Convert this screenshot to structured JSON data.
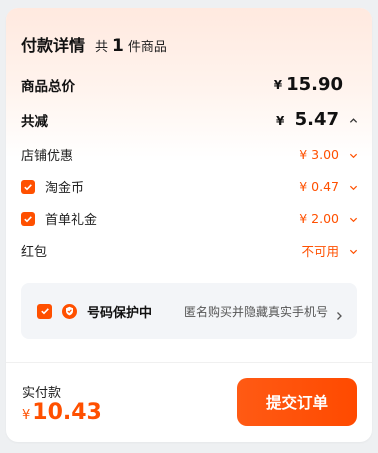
{
  "header": {
    "title": "付款详情",
    "count_prefix": "共",
    "count_num": "1",
    "count_suffix": "件商品"
  },
  "rows": {
    "total": {
      "label": "商品总价",
      "currency": "¥",
      "value": "15.90"
    },
    "reduce": {
      "label": "共减",
      "currency": "¥",
      "value": "5.47"
    },
    "store": {
      "label": "店铺优惠",
      "currency": "¥",
      "value": "3.00"
    },
    "coin": {
      "label": "淘金币",
      "currency": "¥",
      "value": "0.47",
      "checked": true
    },
    "gift": {
      "label": "首单礼金",
      "currency": "¥",
      "value": "2.00",
      "checked": true
    },
    "hongbao": {
      "label": "红包",
      "value": "不可用"
    }
  },
  "privacy": {
    "title": "号码保护中",
    "desc": "匿名购买并隐藏真实手机号",
    "checked": true
  },
  "footer": {
    "pay_label": "实付款",
    "currency": "¥",
    "amount": "10.43",
    "submit_label": "提交订单"
  },
  "colors": {
    "accent": "#ff5000",
    "panel": "#f3f5f8"
  },
  "icons": [
    "checkbox-checked-icon",
    "shield-icon",
    "chevron-down-icon",
    "chevron-up-icon",
    "chevron-right-icon"
  ]
}
